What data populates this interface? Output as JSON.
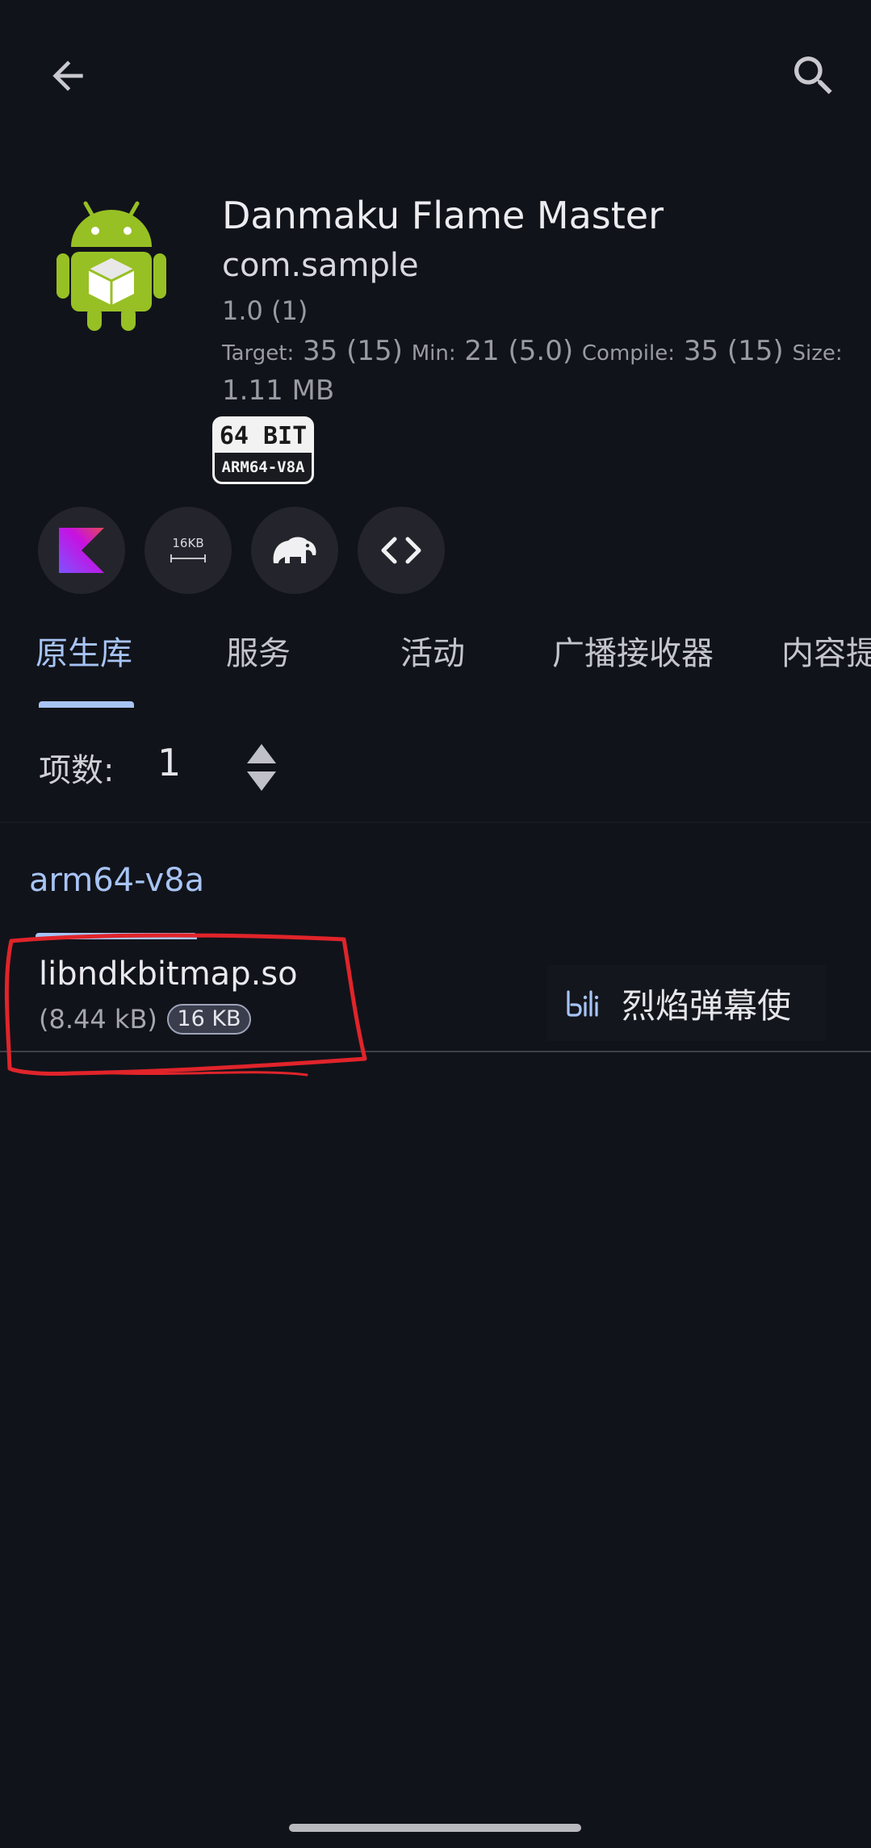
{
  "header": {
    "back_icon": "arrow-left-icon",
    "search_icon": "search-icon"
  },
  "app": {
    "name": "Danmaku Flame Master",
    "package": "com.sample",
    "version": "1.0 (1)",
    "target_label": "Target:",
    "target_value": "35 (15)",
    "min_label": "Min:",
    "min_value": "21 (5.0)",
    "compile_label": "Compile:",
    "compile_value": "35 (15)",
    "size_label": "Size:",
    "size_value": "1.11 MB",
    "bit_badge": {
      "top": "64 BIT",
      "bottom": "ARM64-V8A"
    }
  },
  "chips": [
    {
      "icon": "kotlin-icon"
    },
    {
      "icon": "page-size-16kb-icon",
      "label": "16KB"
    },
    {
      "icon": "gradle-elephant-icon"
    },
    {
      "icon": "code-brackets-icon"
    }
  ],
  "tabs": [
    "原生库",
    "服务",
    "活动",
    "广播接收器",
    "内容提"
  ],
  "active_tab": 0,
  "count": {
    "label": "项数:",
    "value": "1"
  },
  "section": {
    "title": "arm64-v8a"
  },
  "library": {
    "name": "libndkbitmap.so",
    "size": "(8.44 kB)",
    "badge": "16 KB",
    "source_app": "烈焰弹幕使",
    "source_icon": "bilibili-icon"
  },
  "colors": {
    "accent": "#a7c4f5",
    "background": "#11131a",
    "annotation": "#e0242a"
  }
}
